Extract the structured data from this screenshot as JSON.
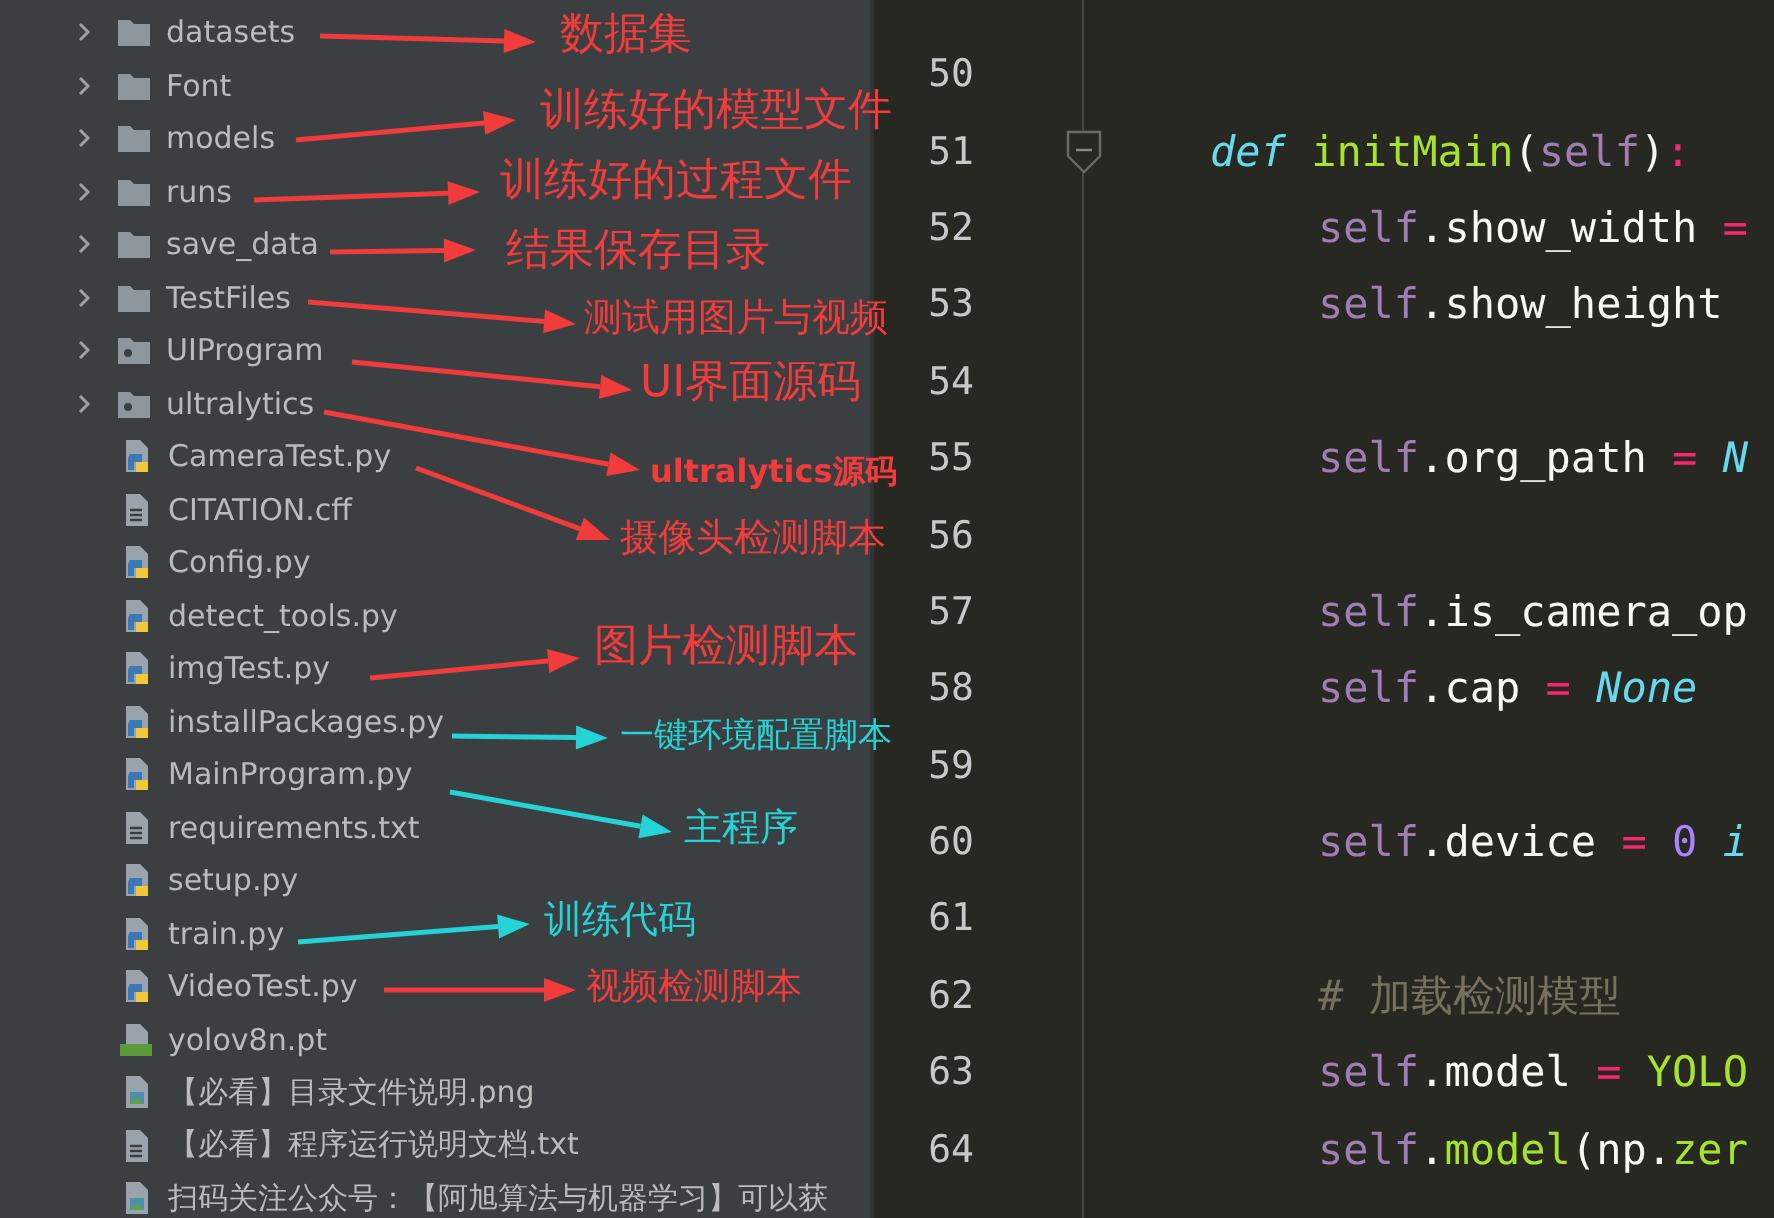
{
  "project_tree": {
    "items": [
      {
        "name": "datasets",
        "kind": "folder",
        "expanded": false,
        "note": {
          "text": "数据集",
          "color": "#f23b3b"
        }
      },
      {
        "name": "Font",
        "kind": "folder",
        "expanded": false
      },
      {
        "name": "models",
        "kind": "folder",
        "expanded": false,
        "note": {
          "text": "训练好的模型文件",
          "color": "#f23b3b"
        }
      },
      {
        "name": "runs",
        "kind": "folder",
        "expanded": false,
        "note": {
          "text": "训练好的过程文件",
          "color": "#f23b3b"
        }
      },
      {
        "name": "save_data",
        "kind": "folder",
        "expanded": false,
        "note": {
          "text": "结果保存目录",
          "color": "#f23b3b"
        }
      },
      {
        "name": "TestFiles",
        "kind": "folder",
        "expanded": false,
        "note": {
          "text": "测试用图片与视频",
          "color": "#f23b3b"
        }
      },
      {
        "name": "UIProgram",
        "kind": "package",
        "expanded": false,
        "note": {
          "text": "UI界面源码",
          "color": "#f23b3b"
        }
      },
      {
        "name": "ultralytics",
        "kind": "package",
        "expanded": false,
        "note": {
          "text": "ultralytics源码",
          "color": "#f23b3b"
        }
      },
      {
        "name": "CameraTest.py",
        "kind": "python",
        "note": {
          "text": "摄像头检测脚本",
          "color": "#f23b3b"
        }
      },
      {
        "name": "CITATION.cff",
        "kind": "text"
      },
      {
        "name": "Config.py",
        "kind": "python"
      },
      {
        "name": "detect_tools.py",
        "kind": "python"
      },
      {
        "name": "imgTest.py",
        "kind": "python",
        "note": {
          "text": "图片检测脚本",
          "color": "#f23b3b"
        }
      },
      {
        "name": "installPackages.py",
        "kind": "python",
        "note": {
          "text": "一键环境配置脚本",
          "color": "#25d3d6"
        }
      },
      {
        "name": "MainProgram.py",
        "kind": "python",
        "note": {
          "text": "主程序",
          "color": "#25d3d6"
        }
      },
      {
        "name": "requirements.txt",
        "kind": "text"
      },
      {
        "name": "setup.py",
        "kind": "python"
      },
      {
        "name": "train.py",
        "kind": "python",
        "note": {
          "text": "训练代码",
          "color": "#25d3d6"
        }
      },
      {
        "name": "VideoTest.py",
        "kind": "python",
        "note": {
          "text": "视频检测脚本",
          "color": "#f23b3b"
        }
      },
      {
        "name": "yolov8n.pt",
        "kind": "model"
      },
      {
        "name": "【必看】目录文件说明.png",
        "kind": "image"
      },
      {
        "name": "【必看】程序运行说明文档.txt",
        "kind": "text"
      },
      {
        "name": "扫码关注公众号：【阿旭算法与机器学习】可以获",
        "kind": "image"
      }
    ]
  },
  "editor": {
    "lines": [
      {
        "number": "50",
        "kind": "blank"
      },
      {
        "number": "51",
        "kind": "def",
        "tokens": [
          {
            "kind": "keyword",
            "text": "def"
          },
          {
            "kind": "func",
            "text": "initMain"
          },
          {
            "kind": "plain",
            "text": "("
          },
          {
            "kind": "self",
            "text": "self"
          },
          {
            "kind": "plain",
            "text": ")"
          },
          {
            "kind": "op",
            "text": ":"
          }
        ]
      },
      {
        "number": "52",
        "kind": "body",
        "tokens": [
          {
            "kind": "self",
            "text": "self"
          },
          {
            "kind": "plain",
            "text": ".show_width "
          },
          {
            "kind": "op",
            "text": "="
          }
        ]
      },
      {
        "number": "53",
        "kind": "body",
        "tokens": [
          {
            "kind": "self",
            "text": "self"
          },
          {
            "kind": "plain",
            "text": ".show_height"
          }
        ]
      },
      {
        "number": "54",
        "kind": "blank"
      },
      {
        "number": "55",
        "kind": "body",
        "tokens": [
          {
            "kind": "self",
            "text": "self"
          },
          {
            "kind": "plain",
            "text": ".org_path "
          },
          {
            "kind": "op",
            "text": "= "
          },
          {
            "kind": "const",
            "text": "N"
          }
        ]
      },
      {
        "number": "56",
        "kind": "blank"
      },
      {
        "number": "57",
        "kind": "body",
        "tokens": [
          {
            "kind": "self",
            "text": "self"
          },
          {
            "kind": "plain",
            "text": ".is_camera_op"
          }
        ]
      },
      {
        "number": "58",
        "kind": "body",
        "tokens": [
          {
            "kind": "self",
            "text": "self"
          },
          {
            "kind": "plain",
            "text": ".cap "
          },
          {
            "kind": "op",
            "text": "= "
          },
          {
            "kind": "const",
            "text": "None"
          }
        ]
      },
      {
        "number": "59",
        "kind": "blank"
      },
      {
        "number": "60",
        "kind": "body",
        "tokens": [
          {
            "kind": "self",
            "text": "self"
          },
          {
            "kind": "plain",
            "text": ".device "
          },
          {
            "kind": "op",
            "text": "= "
          },
          {
            "kind": "number",
            "text": "0 "
          },
          {
            "kind": "const",
            "text": "i"
          }
        ]
      },
      {
        "number": "61",
        "kind": "blank"
      },
      {
        "number": "62",
        "kind": "body",
        "tokens": [
          {
            "kind": "comment",
            "text": "# 加载检测模型"
          }
        ]
      },
      {
        "number": "63",
        "kind": "body",
        "tokens": [
          {
            "kind": "self",
            "text": "self"
          },
          {
            "kind": "plain",
            "text": ".model "
          },
          {
            "kind": "op",
            "text": "= "
          },
          {
            "kind": "func",
            "text": "YOLO"
          }
        ]
      },
      {
        "number": "64",
        "kind": "body",
        "tokens": [
          {
            "kind": "self",
            "text": "self"
          },
          {
            "kind": "plain",
            "text": "."
          },
          {
            "kind": "func",
            "text": "model"
          },
          {
            "kind": "plain",
            "text": "(np."
          },
          {
            "kind": "func",
            "text": "zer"
          }
        ]
      }
    ]
  }
}
